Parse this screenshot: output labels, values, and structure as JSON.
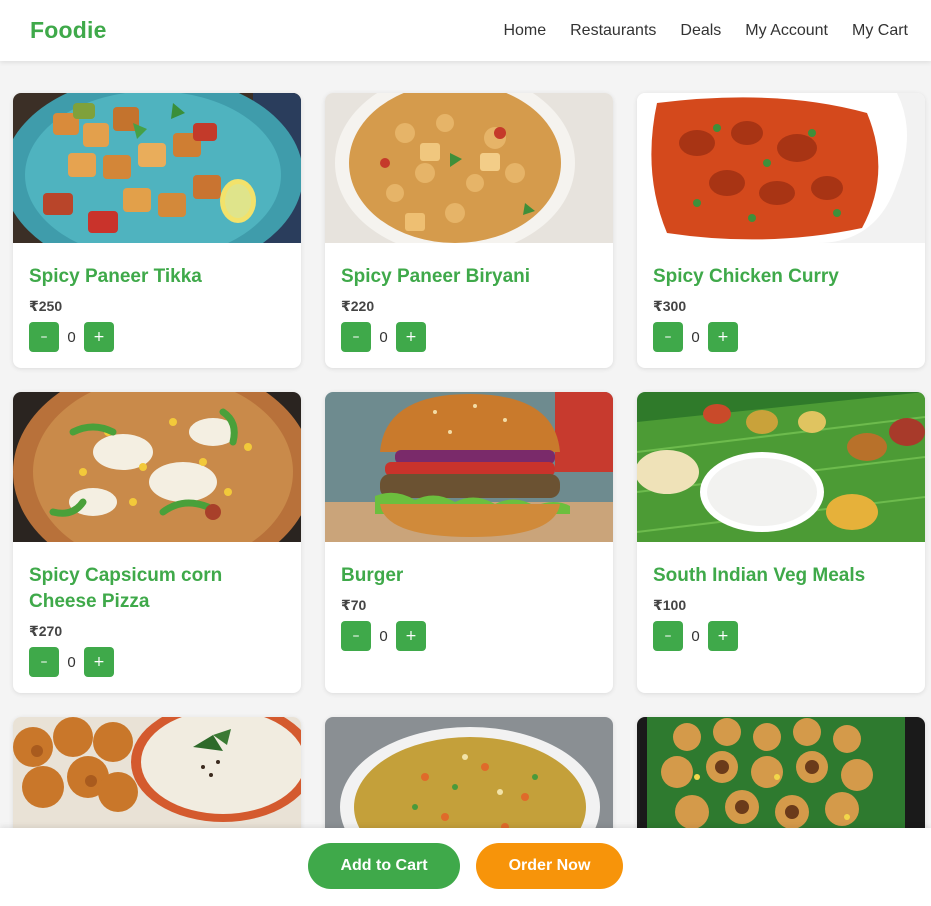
{
  "brand": {
    "name": "Foodie",
    "color": "#3fa94a"
  },
  "nav": {
    "items": [
      {
        "label": "Home"
      },
      {
        "label": "Restaurants"
      },
      {
        "label": "Deals"
      },
      {
        "label": "My Account"
      },
      {
        "label": "My Cart"
      }
    ]
  },
  "menu": {
    "items": [
      {
        "name": "Spicy Paneer Tikka",
        "price": "₹250",
        "qty": "0",
        "minus": "–",
        "plus": "+",
        "image": "paneer-tikka-photo"
      },
      {
        "name": "Spicy Paneer Biryani",
        "price": "₹220",
        "qty": "0",
        "minus": "–",
        "plus": "+",
        "image": "paneer-biryani-photo"
      },
      {
        "name": "Spicy Chicken Curry",
        "price": "₹300",
        "qty": "0",
        "minus": "–",
        "plus": "+",
        "image": "chicken-curry-photo"
      },
      {
        "name": "Spicy Capsicum corn Cheese Pizza",
        "price": "₹270",
        "qty": "0",
        "minus": "–",
        "plus": "+",
        "image": "capsicum-corn-pizza-photo"
      },
      {
        "name": "Burger",
        "price": "₹70",
        "qty": "0",
        "minus": "–",
        "plus": "+",
        "image": "burger-photo"
      },
      {
        "name": "South Indian Veg Meals",
        "price": "₹100",
        "qty": "0",
        "minus": "–",
        "plus": "+",
        "image": "south-indian-meals-photo"
      },
      {
        "image": "bonda-chutney-photo"
      },
      {
        "image": "upma-poha-photo"
      },
      {
        "image": "pani-puri-photo"
      }
    ]
  },
  "actions": {
    "add_to_cart": "Add to Cart",
    "order_now": "Order Now"
  },
  "colors": {
    "accent": "#3fa94a",
    "order": "#f7940a"
  }
}
